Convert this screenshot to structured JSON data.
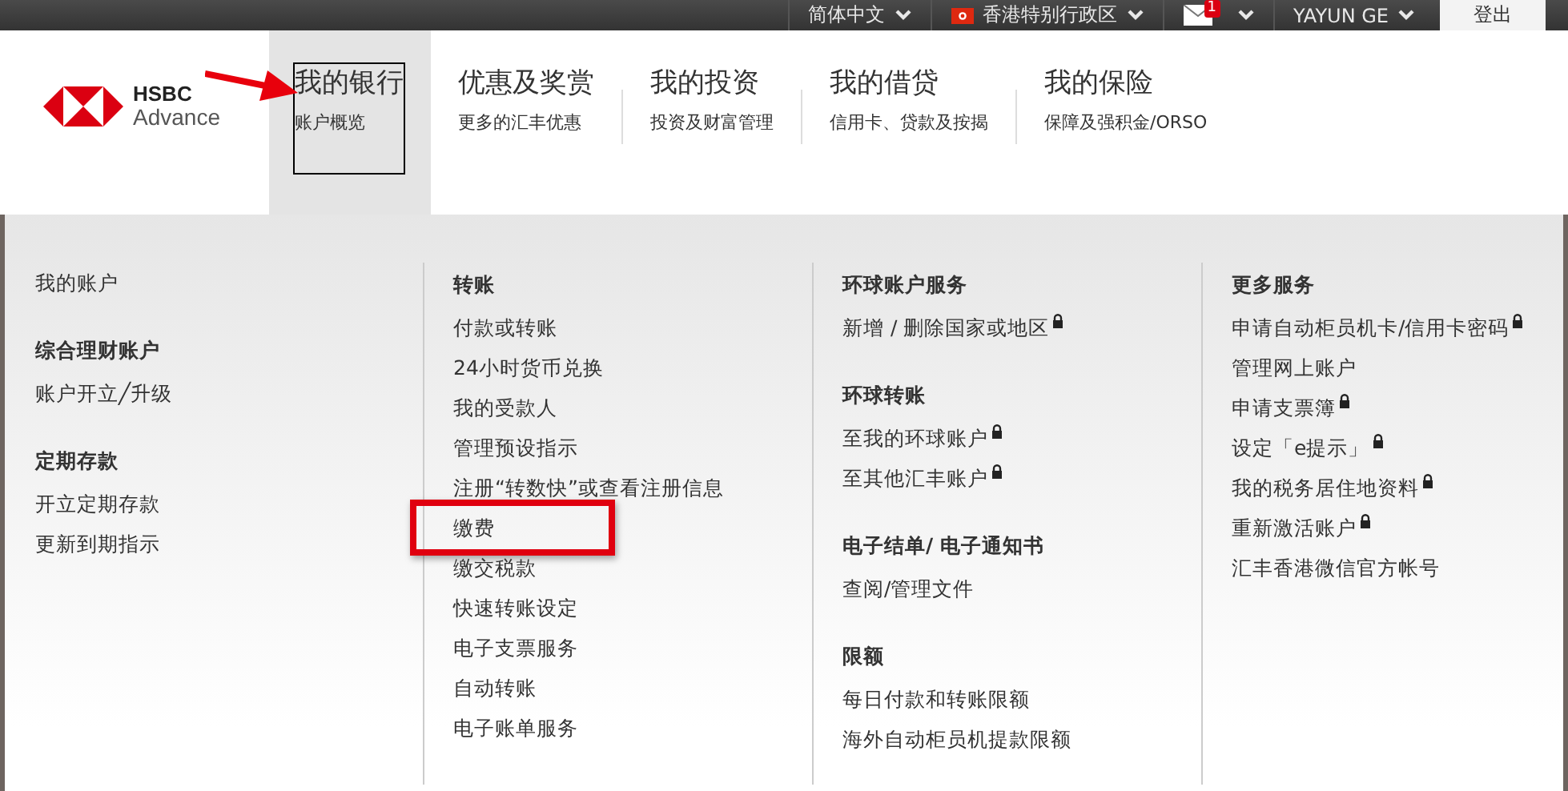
{
  "top_bar": {
    "items": [
      {
        "kind": "menu",
        "label": "简体中文"
      },
      {
        "kind": "region",
        "label": "香港特别行政区"
      },
      {
        "kind": "mail",
        "badge": "1"
      },
      {
        "kind": "menu",
        "label": "YAYUN GE"
      }
    ],
    "logout": "登出"
  },
  "logo": {
    "line1": "HSBC",
    "line2": "Advance"
  },
  "nav": [
    {
      "title": "我的银行",
      "subtitle": "账户概览",
      "selected": true,
      "outlined": true
    },
    {
      "title": "优惠及奖赏",
      "subtitle": "更多的汇丰优惠",
      "selected": false,
      "outlined": false
    },
    {
      "title": "我的投资",
      "subtitle": "投资及财富管理",
      "selected": false,
      "outlined": false
    },
    {
      "title": "我的借贷",
      "subtitle": "信用卡、贷款及按揭",
      "selected": false,
      "outlined": false
    },
    {
      "title": "我的保险",
      "subtitle": "保障及强积金/ORSO",
      "selected": false,
      "outlined": false
    }
  ],
  "mega_menu": {
    "columns": [
      {
        "groups": [
          {
            "items": [
              {
                "label": "我的账户",
                "locked": false,
                "highlighted": false
              }
            ]
          },
          {
            "heading": "综合理财账户",
            "items": [
              {
                "label": "账户开立╱升级",
                "locked": false,
                "highlighted": false
              }
            ]
          },
          {
            "heading": "定期存款",
            "items": [
              {
                "label": "开立定期存款",
                "locked": false,
                "highlighted": false
              },
              {
                "label": "更新到期指示",
                "locked": false,
                "highlighted": false
              }
            ]
          }
        ]
      },
      {
        "groups": [
          {
            "heading": "转账",
            "items": [
              {
                "label": "付款或转账",
                "locked": false,
                "highlighted": false
              },
              {
                "label": "24小时货币兑换",
                "locked": false,
                "highlighted": false
              },
              {
                "label": "我的受款人",
                "locked": false,
                "highlighted": false
              },
              {
                "label": "管理预设指示",
                "locked": false,
                "highlighted": false
              },
              {
                "label": "注册“转数快”或查看注册信息",
                "locked": false,
                "highlighted": false
              },
              {
                "label": "缴费",
                "locked": false,
                "highlighted": true
              },
              {
                "label": "缴交税款",
                "locked": false,
                "highlighted": false
              },
              {
                "label": "快速转账设定",
                "locked": false,
                "highlighted": false
              },
              {
                "label": "电子支票服务",
                "locked": false,
                "highlighted": false
              },
              {
                "label": "自动转账",
                "locked": false,
                "highlighted": false
              },
              {
                "label": "电子账单服务",
                "locked": false,
                "highlighted": false
              }
            ]
          }
        ]
      },
      {
        "groups": [
          {
            "heading": "环球账户服务",
            "items": [
              {
                "label": "新增 / 删除国家或地区",
                "locked": true,
                "highlighted": false
              }
            ]
          },
          {
            "heading": "环球转账",
            "items": [
              {
                "label": "至我的环球账户",
                "locked": true,
                "highlighted": false
              },
              {
                "label": "至其他汇丰账户",
                "locked": true,
                "highlighted": false
              }
            ]
          },
          {
            "heading": "电子结单/ 电子通知书",
            "items": [
              {
                "label": "查阅/管理文件",
                "locked": false,
                "highlighted": false
              }
            ]
          },
          {
            "heading": "限额",
            "items": [
              {
                "label": "每日付款和转账限额",
                "locked": false,
                "highlighted": false
              },
              {
                "label": "海外自动柜员机提款限额",
                "locked": false,
                "highlighted": false
              }
            ]
          }
        ]
      },
      {
        "groups": [
          {
            "heading": "更多服务",
            "items": [
              {
                "label": "申请自动柜员机卡/信用卡密码",
                "locked": true,
                "highlighted": false
              },
              {
                "label": "管理网上账户",
                "locked": false,
                "highlighted": false
              },
              {
                "label": "申请支票簿",
                "locked": true,
                "highlighted": false
              },
              {
                "label": "设定「e提示」",
                "locked": true,
                "highlighted": false
              },
              {
                "label": "我的税务居住地资料",
                "locked": true,
                "highlighted": false
              },
              {
                "label": "重新激活账户",
                "locked": true,
                "highlighted": false
              },
              {
                "label": "汇丰香港微信官方帐号",
                "locked": false,
                "highlighted": false
              }
            ]
          }
        ]
      }
    ]
  }
}
